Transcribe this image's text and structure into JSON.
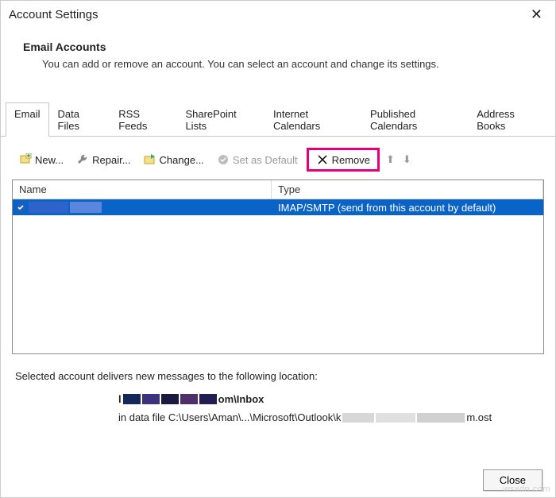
{
  "window": {
    "title": "Account Settings"
  },
  "header": {
    "title": "Email Accounts",
    "subtitle": "You can add or remove an account. You can select an account and change its settings."
  },
  "tabs": [
    {
      "label": "Email",
      "active": true
    },
    {
      "label": "Data Files"
    },
    {
      "label": "RSS Feeds"
    },
    {
      "label": "SharePoint Lists"
    },
    {
      "label": "Internet Calendars"
    },
    {
      "label": "Published Calendars"
    },
    {
      "label": "Address Books"
    }
  ],
  "toolbar": {
    "new_label": "New...",
    "repair_label": "Repair...",
    "change_label": "Change...",
    "default_label": "Set as Default",
    "remove_label": "Remove"
  },
  "columns": {
    "name": "Name",
    "type": "Type"
  },
  "accounts": [
    {
      "name_redacted": true,
      "type": "IMAP/SMTP (send from this account by default)"
    }
  ],
  "location": {
    "intro": "Selected account delivers new messages to the following location:",
    "folder_prefix": "l",
    "folder_suffix": "om\\Inbox",
    "datafile_prefix": "in data file C:\\Users\\Aman\\...\\Microsoft\\Outlook\\k",
    "datafile_suffix": "m.ost"
  },
  "buttons": {
    "close": "Close"
  },
  "watermark": "wsxdn.com"
}
